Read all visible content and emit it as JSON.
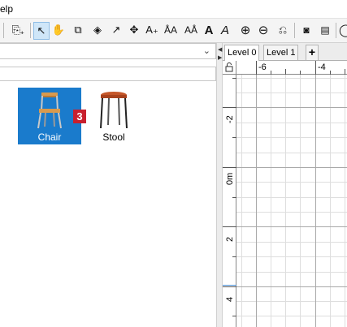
{
  "menubar": {
    "help_label": "elp"
  },
  "toolbar": {
    "buttons": [
      {
        "name": "add-furniture-icon",
        "glyph": "⎘+"
      },
      {
        "name": "select-mode-icon",
        "glyph": "↖"
      },
      {
        "name": "pan-mode-icon",
        "glyph": "✋"
      },
      {
        "name": "create-walls-icon",
        "glyph": "⧉"
      },
      {
        "name": "create-rooms-icon",
        "glyph": "◈"
      },
      {
        "name": "create-polylines-icon",
        "glyph": "↗"
      },
      {
        "name": "create-dimensions-icon",
        "glyph": "✥"
      },
      {
        "name": "add-text-icon",
        "glyph": "A₊"
      },
      {
        "name": "text-bold-small-icon",
        "glyph": "ÅA"
      },
      {
        "name": "text-size-icon",
        "glyph": "Aᴬ"
      },
      {
        "name": "text-bold-icon",
        "glyph": "A"
      },
      {
        "name": "text-italic-icon",
        "glyph": "A"
      },
      {
        "name": "zoom-in-icon",
        "glyph": "⊕"
      },
      {
        "name": "zoom-out-icon",
        "glyph": "⊖"
      },
      {
        "name": "import-furniture-icon",
        "glyph": "⎌"
      },
      {
        "name": "create-photo-icon",
        "glyph": "📷"
      },
      {
        "name": "create-video-icon",
        "glyph": "🎞"
      },
      {
        "name": "help-icon",
        "glyph": "◯"
      }
    ]
  },
  "catalog": {
    "items": [
      {
        "label": "Chair",
        "selected": true
      },
      {
        "label": "Stool",
        "selected": false
      }
    ],
    "badge": "3"
  },
  "plan": {
    "tabs": [
      {
        "label": "Level 0",
        "active": true
      },
      {
        "label": "Level 1",
        "active": false
      }
    ],
    "add_tab_label": "+",
    "ruler_top_labels": [
      "-6",
      "-4"
    ],
    "ruler_left_labels": [
      "-2",
      "0m",
      "2",
      "4"
    ]
  }
}
